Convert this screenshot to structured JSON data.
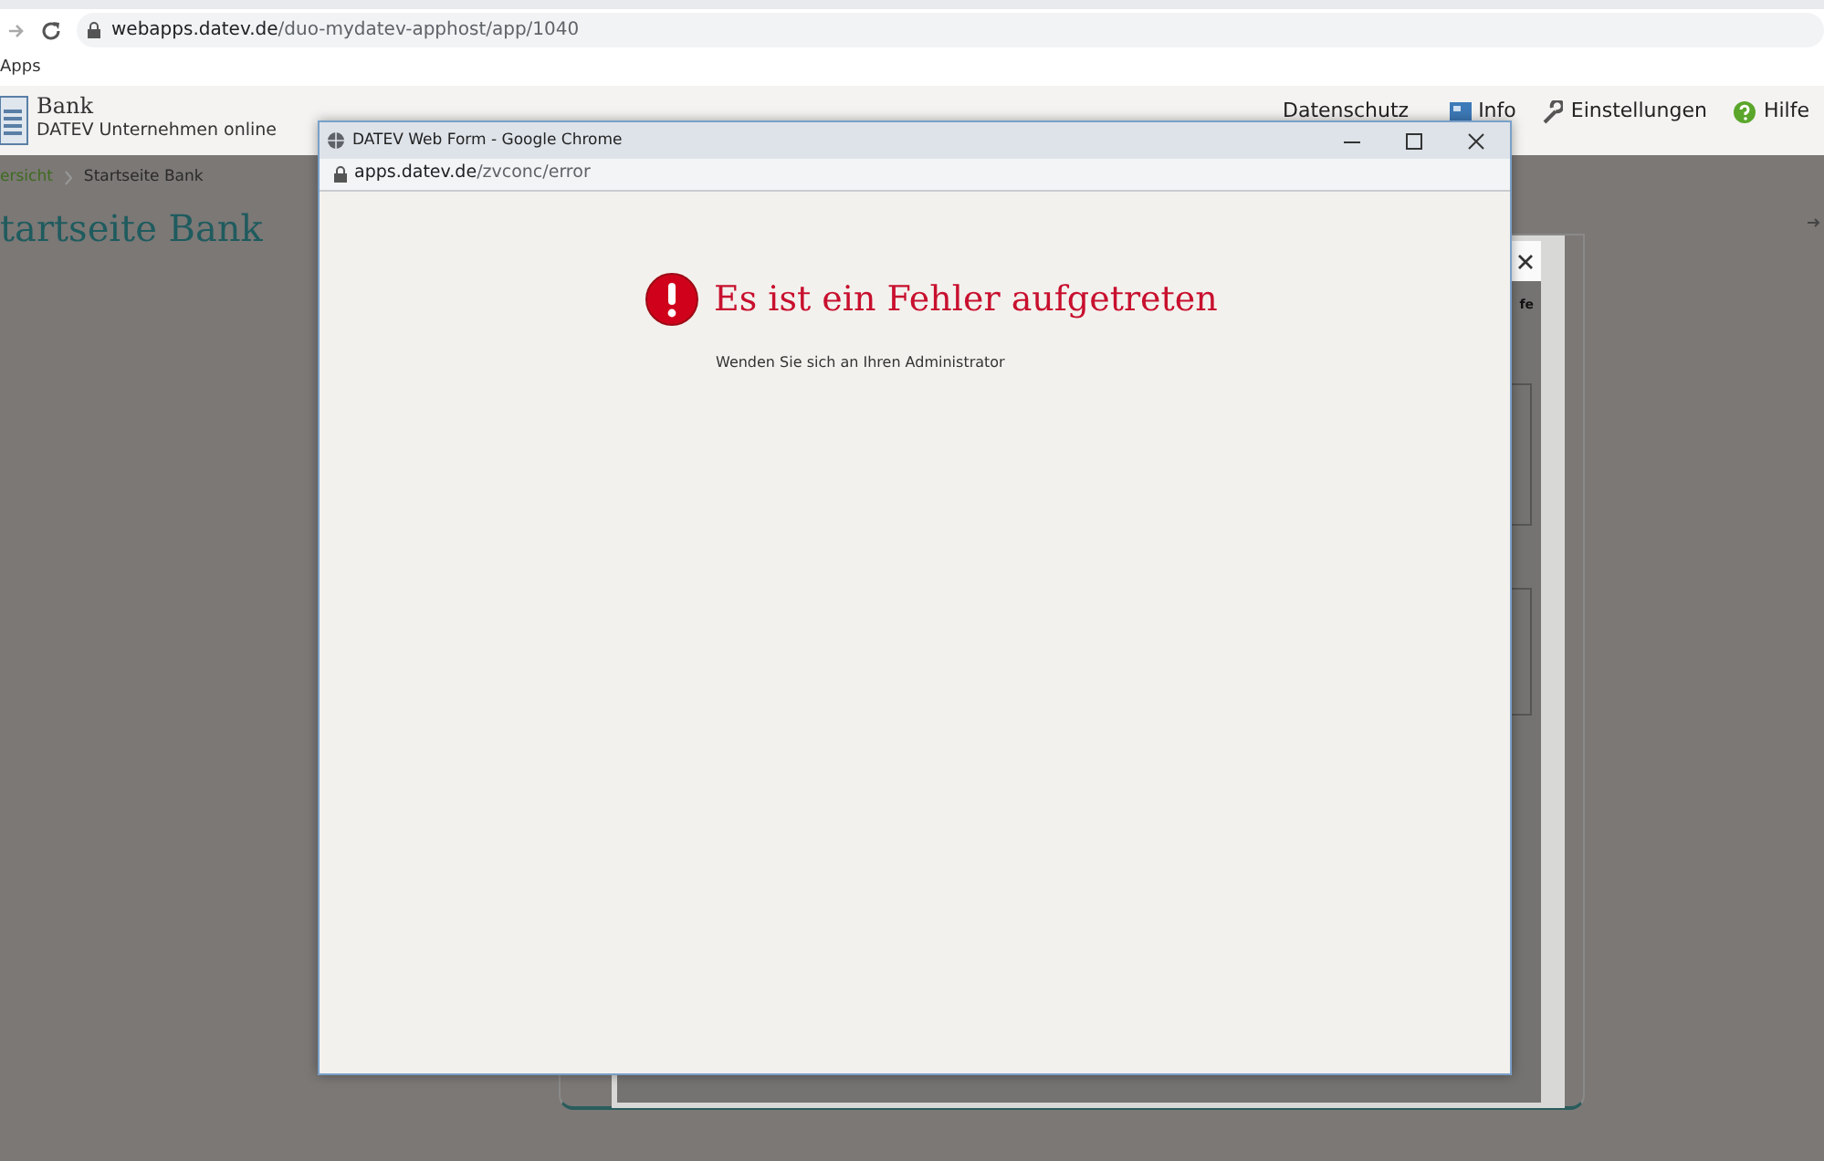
{
  "browser": {
    "url_host": "webapps.datev.de",
    "url_path": "/duo-mydatev-apphost/app/1040",
    "bookmarks": [
      "Apps"
    ]
  },
  "app_header": {
    "title": "Bank",
    "subtitle": "DATEV Unternehmen online",
    "links": [
      {
        "label": "Datenschutz",
        "kind": "plain"
      },
      {
        "label": "Info",
        "kind": "info"
      },
      {
        "label": "Einstellungen",
        "kind": "settings"
      },
      {
        "label": "Hilfe",
        "kind": "help"
      }
    ]
  },
  "breadcrumb": [
    "ersicht",
    "Startseite Bank"
  ],
  "page_title": "tartseite Bank",
  "background_dialog": {
    "header_text": "fe"
  },
  "popup": {
    "title": "DATEV Web Form - Google Chrome",
    "url_host": "apps.datev.de",
    "url_path": "/zvconc/error",
    "error_title": "Es ist ein Fehler aufgetreten",
    "error_message": "Wenden Sie sich an Ihren Administrator"
  }
}
